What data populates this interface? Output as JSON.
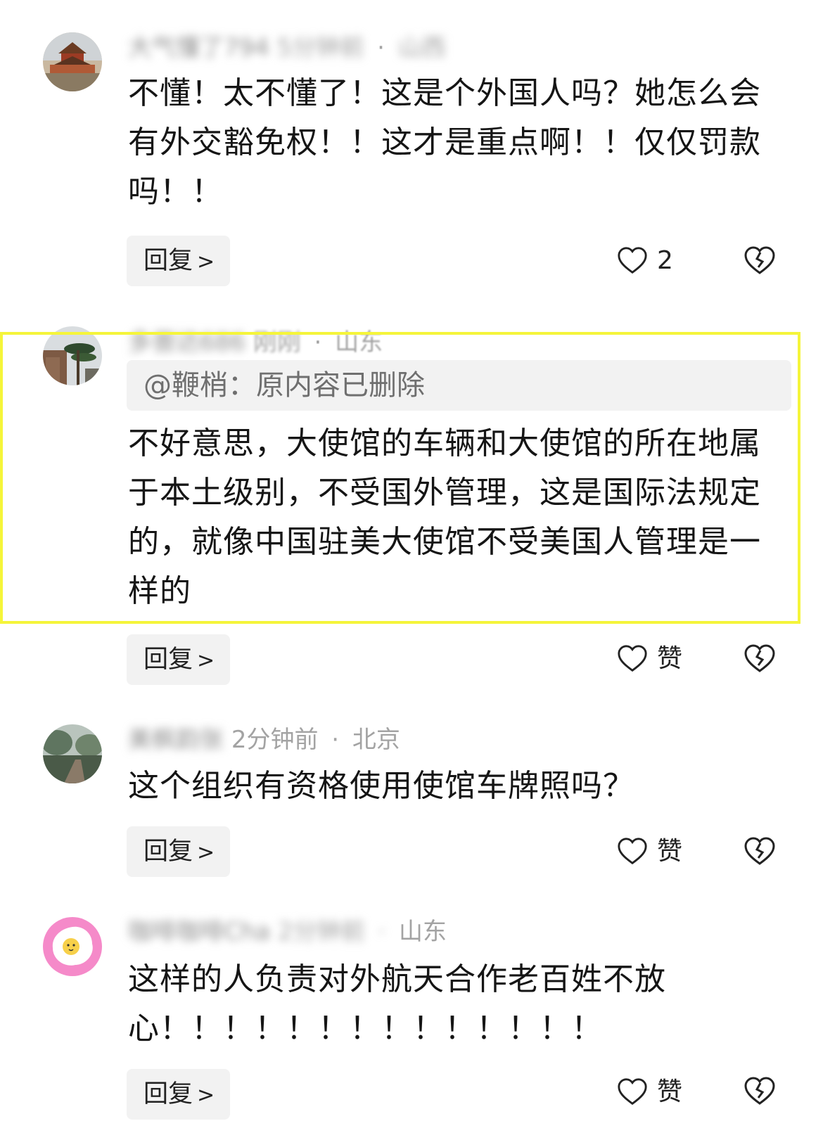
{
  "colors": {
    "highlight": "#f5f53a",
    "muted": "#a3a3a3",
    "button_bg": "#f2f2f2"
  },
  "comments": [
    {
      "name": "大气懂了794",
      "time": "5分钟前",
      "location": "山西",
      "text": "不懂！太不懂了！这是个外国人吗？她怎么会有外交豁免权！！这才是重点啊！！仅仅罚款吗！！",
      "reply_label": "回复",
      "like_label": "2",
      "avatar_icon": "palace-photo-avatar"
    },
    {
      "name": "多普达686",
      "time": "刚刚",
      "location": "山东",
      "quote": "@鞭梢：原内容已删除",
      "text": "不好意思，大使馆的车辆和大使馆的所在地属于本土级别，不受国外管理，这是国际法规定的，就像中国驻美大使馆不受美国人管理是一样的",
      "reply_label": "回复",
      "like_label": "赞",
      "avatar_icon": "pine-mountain-avatar"
    },
    {
      "name": "美枫韵张",
      "time": "2分钟前",
      "location": "北京",
      "text": "这个组织有资格使用使馆车牌照吗？",
      "reply_label": "回复",
      "like_label": "赞",
      "avatar_icon": "forest-bridge-avatar"
    },
    {
      "name": "咖啡咖啡Cha",
      "time": "2分钟前",
      "location": "山东",
      "text": "这样的人负责对外航天合作老百姓不放心！！！！！！！！！！！！！！",
      "reply_label": "回复",
      "like_label": "赞",
      "avatar_icon": "fried-egg-avatar"
    }
  ],
  "separator": "·"
}
